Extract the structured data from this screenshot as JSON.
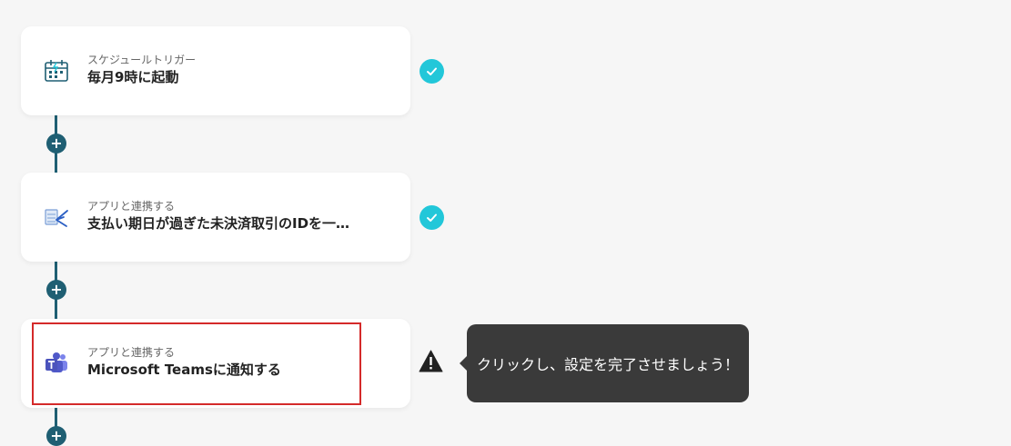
{
  "flow": {
    "steps": [
      {
        "subtitle": "スケジュールトリガー",
        "title": "毎月9時に起動",
        "icon": "calendar-clock-icon",
        "status": "complete"
      },
      {
        "subtitle": "アプリと連携する",
        "title": "支払い期日が過ぎた未決済取引のIDを一…",
        "icon": "freee-accounting-icon",
        "status": "complete"
      },
      {
        "subtitle": "アプリと連携する",
        "title": "Microsoft Teamsに通知する",
        "icon": "microsoft-teams-icon",
        "status": "warning"
      }
    ],
    "add_step_label": "+"
  },
  "tooltip": {
    "text": "クリックし、設定を完了させましょう！"
  },
  "colors": {
    "connector": "#1f5f73",
    "check": "#22c7d9",
    "highlight": "#d42a2a",
    "tooltip_bg": "#3a3a3a"
  }
}
